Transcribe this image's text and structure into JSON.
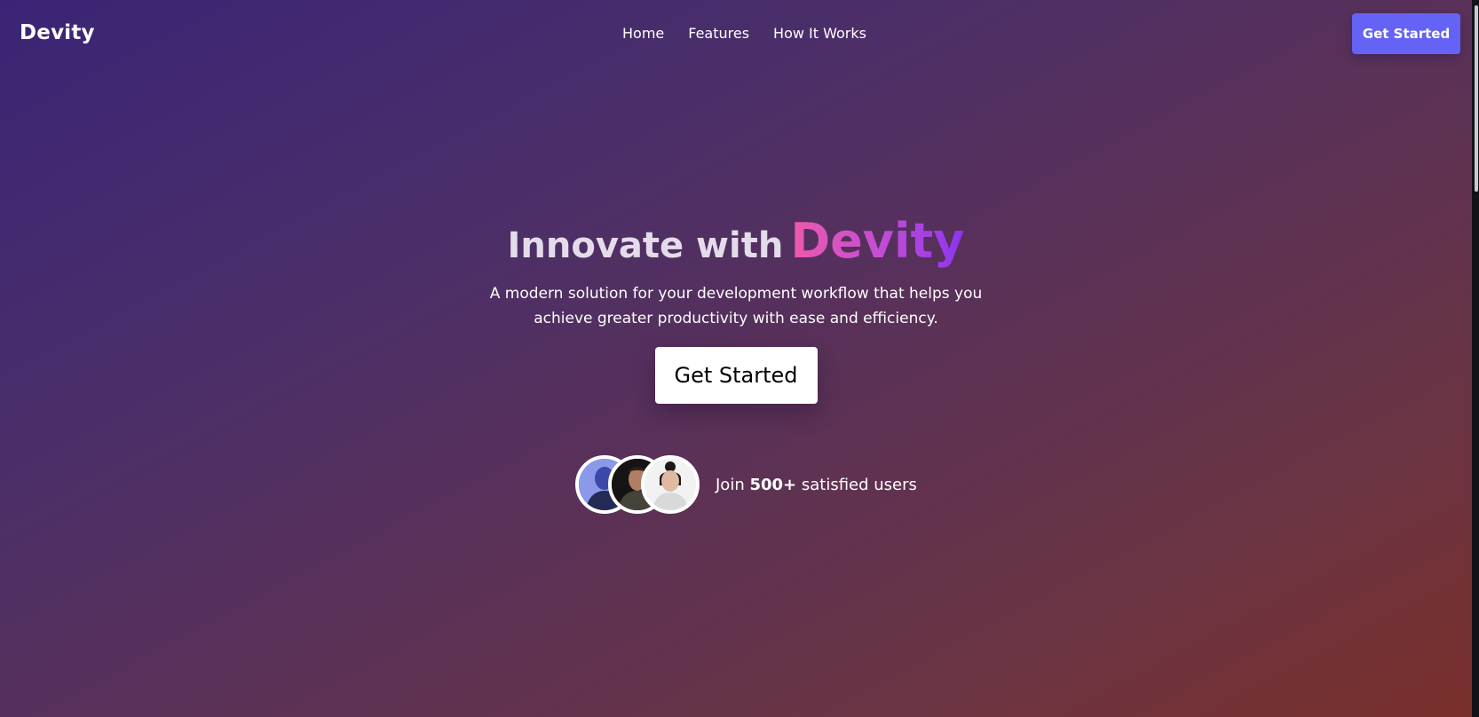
{
  "header": {
    "logo": "Devity",
    "nav": [
      "Home",
      "Features",
      "How It Works"
    ],
    "cta_label": "Get Started",
    "cta_color": "#6563f5"
  },
  "hero": {
    "title_prefix": "Innovate with",
    "title_brand": "Devity",
    "subtitle": "A modern solution for your development workflow that helps you achieve greater productivity with ease and efficiency.",
    "cta_label": "Get Started"
  },
  "social_proof": {
    "prefix": "Join",
    "count": "500+",
    "suffix": "satisfied users",
    "avatars": [
      "user-avatar-1",
      "user-avatar-2",
      "user-avatar-3"
    ]
  },
  "colors": {
    "brand_gradient_start": "#ee5aa9",
    "brand_gradient_end": "#8c34ef",
    "background_top": "#3b2476",
    "background_bottom": "#7a2f2b"
  }
}
